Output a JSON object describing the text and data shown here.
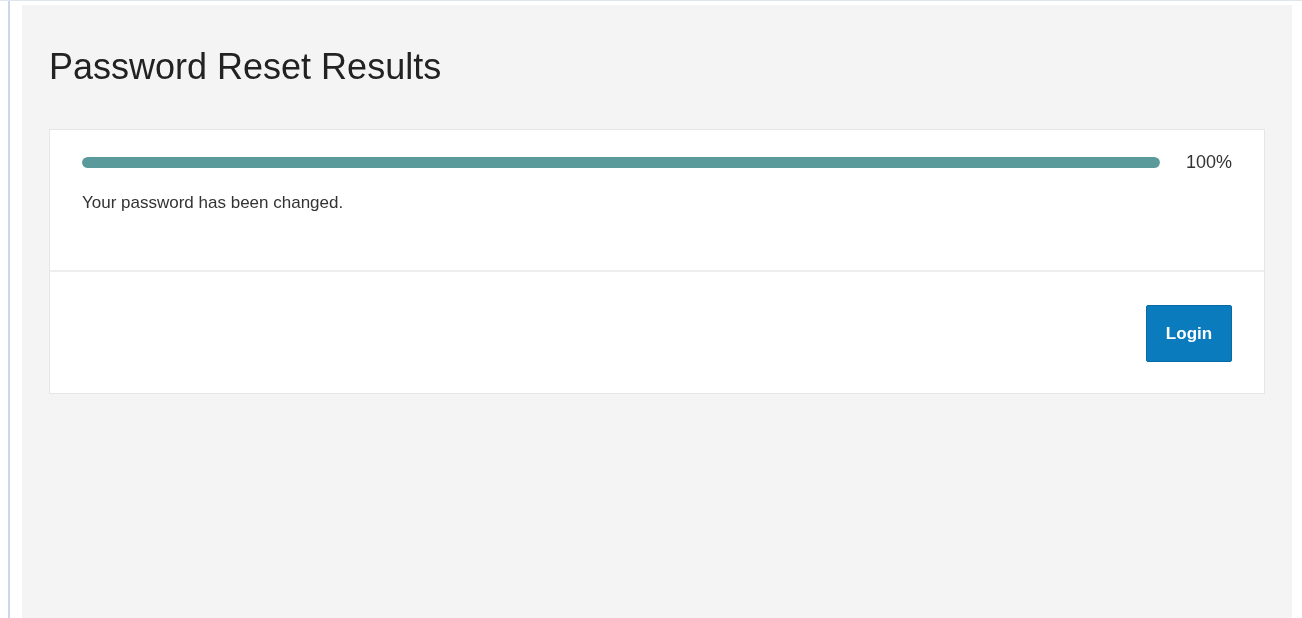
{
  "page": {
    "title": "Password Reset Results"
  },
  "progress": {
    "level": 1.0,
    "reading": "100%"
  },
  "message": "Your password has been changed.",
  "buttons": [
    {
      "label": "Login"
    }
  ]
}
